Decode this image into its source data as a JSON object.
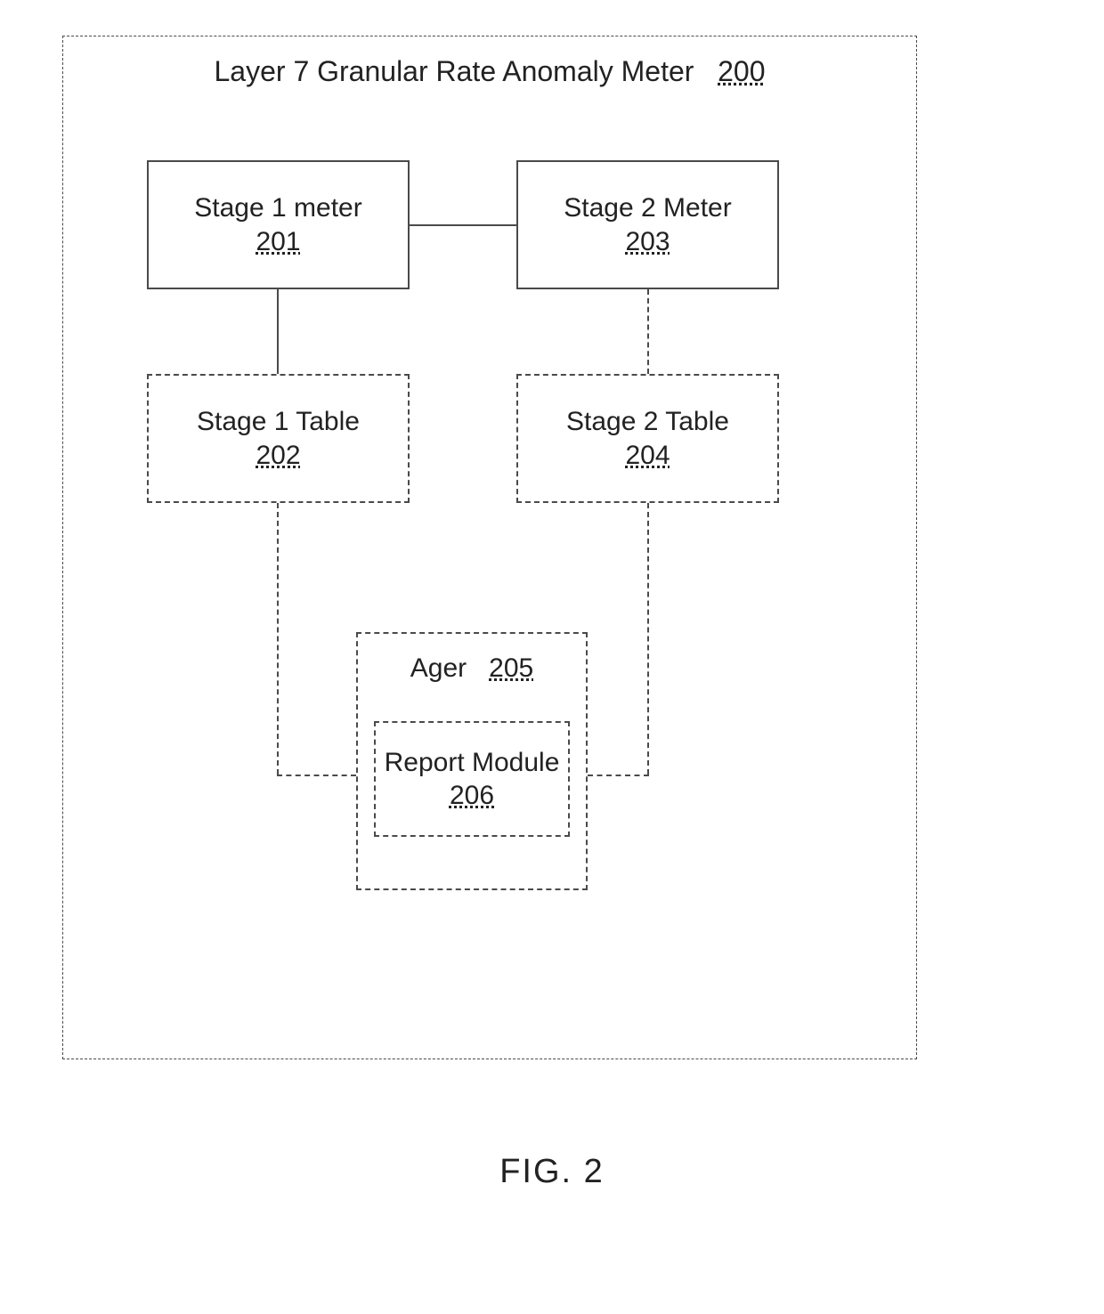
{
  "title": {
    "text": "Layer 7 Granular Rate Anomaly Meter",
    "ref": "200"
  },
  "stage1meter": {
    "label": "Stage 1 meter",
    "ref": "201"
  },
  "stage1table": {
    "label": "Stage 1 Table",
    "ref": "202"
  },
  "stage2meter": {
    "label": "Stage 2 Meter",
    "ref": "203"
  },
  "stage2table": {
    "label": "Stage 2 Table",
    "ref": "204"
  },
  "ager": {
    "label": "Ager",
    "ref": "205"
  },
  "report": {
    "label": "Report Module",
    "ref": "206"
  },
  "caption": "FIG. 2"
}
